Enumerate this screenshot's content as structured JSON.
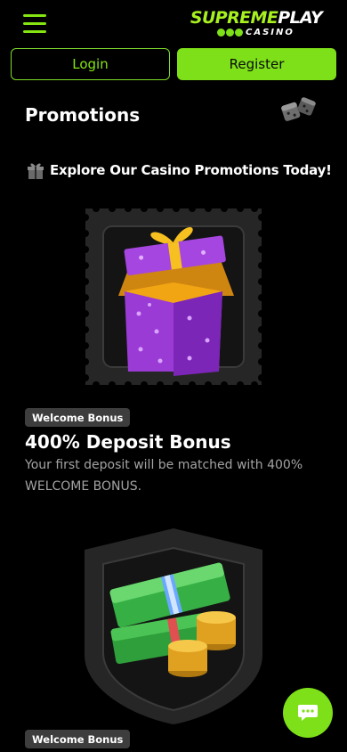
{
  "header": {
    "logo_word1": "SUPREME",
    "logo_word2": "PLAY",
    "logo_sub": "CASINO"
  },
  "auth": {
    "login_label": "Login",
    "register_label": "Register"
  },
  "page": {
    "title": "Promotions",
    "explore_text": "Explore Our Casino Promotions Today!"
  },
  "promotions": [
    {
      "badge": "Welcome Bonus",
      "title": "400% Deposit Bonus",
      "description": "Your first deposit will be matched with 400% WELCOME BONUS.",
      "image_icon": "gift-box-icon"
    },
    {
      "badge": "Welcome Bonus",
      "image_icon": "cash-and-coins-icon"
    }
  ],
  "colors": {
    "accent": "#7de018",
    "background": "#000000",
    "badge_bg": "#3d3d3d",
    "muted_text": "#a3a3a3"
  }
}
